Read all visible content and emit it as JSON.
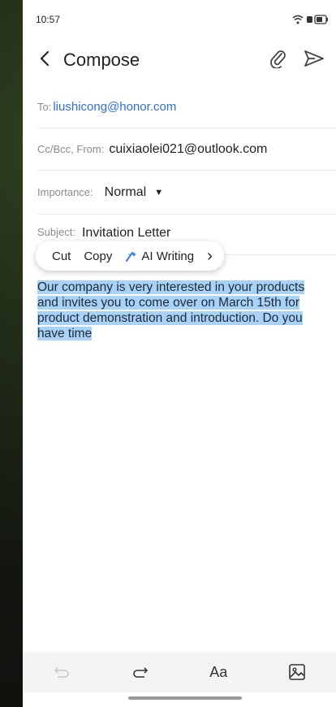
{
  "status_bar": {
    "time": "10:57",
    "icons": [
      "wifi-icon",
      "battery-icon"
    ]
  },
  "header": {
    "title": "Compose",
    "back_icon": "back-chevron-icon",
    "attach_icon": "paperclip-icon",
    "send_icon": "send-icon"
  },
  "fields": {
    "to_label": "To:",
    "to_value": "liushicong@honor.com",
    "cc_label": "Cc/Bcc, From:",
    "cc_value": "cuixiaolei021@outlook.com",
    "importance_label": "Importance:",
    "importance_value": "Normal",
    "subject_label": "Subject:",
    "subject_value": "Invitation Letter"
  },
  "context_menu": {
    "cut": "Cut",
    "copy": "Copy",
    "ai_writing": "AI Writing",
    "more": "›"
  },
  "body": {
    "text": "Our company is very interested in your products and invites you to come over on March 15th for product demonstration and introduction. Do you have time",
    "selected": true
  },
  "toolbar": {
    "undo_icon": "undo-icon",
    "redo_icon": "redo-icon",
    "format_label": "Aa",
    "image_icon": "image-icon"
  },
  "colors": {
    "link": "#2f6ed8",
    "selection": "#a9d2f7",
    "ai_icon": "#3a7be0"
  }
}
